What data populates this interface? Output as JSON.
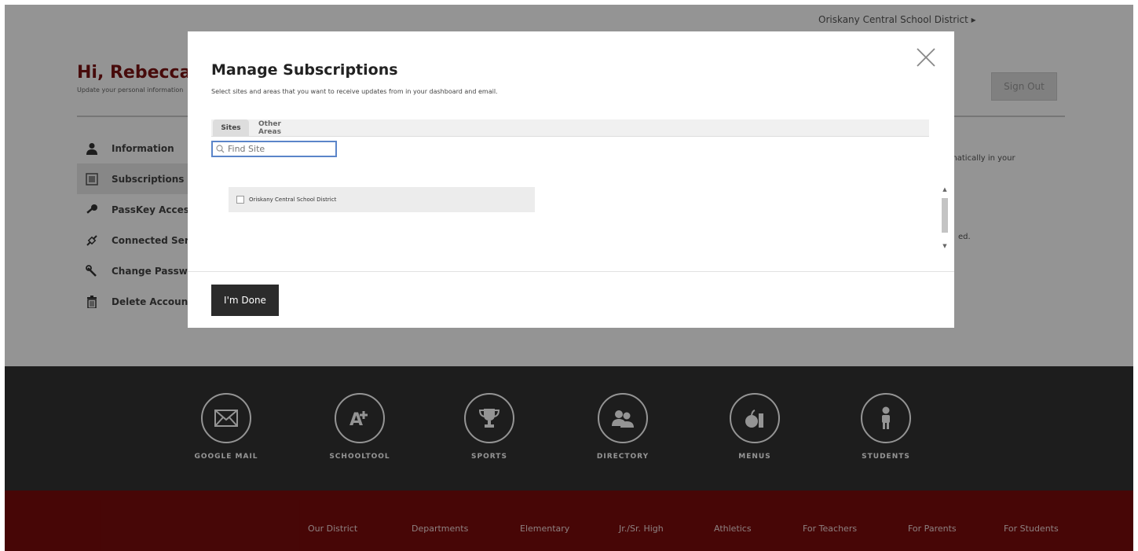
{
  "header": {
    "district_link": "Oriskany Central School District ▸",
    "greeting": "Hi, Rebecca",
    "greeting_sub": "Update your personal information",
    "sign_out": "Sign Out"
  },
  "side_menu": {
    "items": [
      {
        "label": "Information",
        "icon": "person-icon"
      },
      {
        "label": "Subscriptions",
        "icon": "subscriptions-icon"
      },
      {
        "label": "PassKey Access",
        "icon": "key-icon"
      },
      {
        "label": "Connected Services",
        "icon": "link-icon"
      },
      {
        "label": "Change Password",
        "icon": "wrench-icon"
      },
      {
        "label": "Delete Account",
        "icon": "trash-icon"
      }
    ]
  },
  "background_text": {
    "line1": "matically in your",
    "line2": "ed."
  },
  "quick_links": [
    {
      "label": "GOOGLE MAIL",
      "icon": "mail-icon"
    },
    {
      "label": "SCHOOLTOOL",
      "icon": "grade-icon"
    },
    {
      "label": "SPORTS",
      "icon": "trophy-icon"
    },
    {
      "label": "DIRECTORY",
      "icon": "people-icon"
    },
    {
      "label": "MENUS",
      "icon": "apple-icon"
    },
    {
      "label": "STUDENTS",
      "icon": "student-icon"
    }
  ],
  "footer_nav": [
    "Our District",
    "Departments",
    "Elementary",
    "Jr./Sr. High",
    "Athletics",
    "For Teachers",
    "For Parents",
    "For Students"
  ],
  "modal": {
    "title": "Manage Subscriptions",
    "subtitle": "Select sites and areas that you want to receive updates from in your dashboard and email.",
    "tabs": [
      "Sites",
      "Other Areas"
    ],
    "search_placeholder": "Find Site",
    "sites": [
      {
        "name": "Oriskany Central School District",
        "checked": false
      }
    ],
    "done_label": "I'm Done"
  },
  "colors": {
    "brand_red": "#7a0c0c",
    "dark_band": "#333333",
    "button_dark": "#2b2b2b",
    "focus_blue": "#5b85c9"
  }
}
